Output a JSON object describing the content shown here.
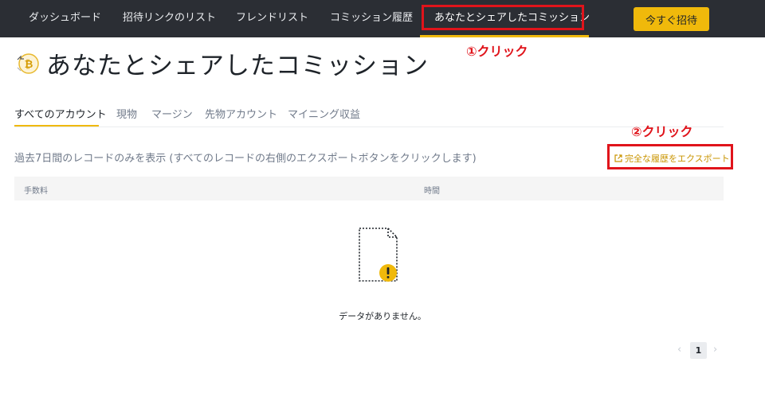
{
  "nav": {
    "items": [
      {
        "label": "ダッシュボード"
      },
      {
        "label": "招待リンクのリスト"
      },
      {
        "label": "フレンドリスト"
      },
      {
        "label": "コミッション履歴"
      },
      {
        "label": "あなたとシェアしたコミッション"
      }
    ],
    "active_index": 4,
    "invite_button": "今すぐ招待"
  },
  "annotations": {
    "step1": "①クリック",
    "step2": "②クリック",
    "color": "#e0141b"
  },
  "page": {
    "title": "あなたとシェアしたコミッション",
    "tabs": [
      {
        "label": "すべてのアカウント"
      },
      {
        "label": "現物"
      },
      {
        "label": "マージン"
      },
      {
        "label": "先物アカウント"
      },
      {
        "label": "マイニング収益"
      }
    ],
    "active_tab": 0,
    "info": "過去7日間のレコードのみを表示 (すべてのレコードの右側のエクスポートボタンをクリックします)",
    "export_label": "完全な履歴をエクスポート",
    "columns": [
      "手数料",
      "時間"
    ],
    "empty_message": "データがありません。",
    "pagination": {
      "current": "1",
      "prev": "‹",
      "next": "›"
    }
  },
  "colors": {
    "accent": "#f0b90b",
    "nav_background": "#2b2e34",
    "export_link": "#c99400"
  },
  "icons": [
    "coin-icon",
    "external-link-icon",
    "empty-document-icon",
    "warning-icon"
  ]
}
